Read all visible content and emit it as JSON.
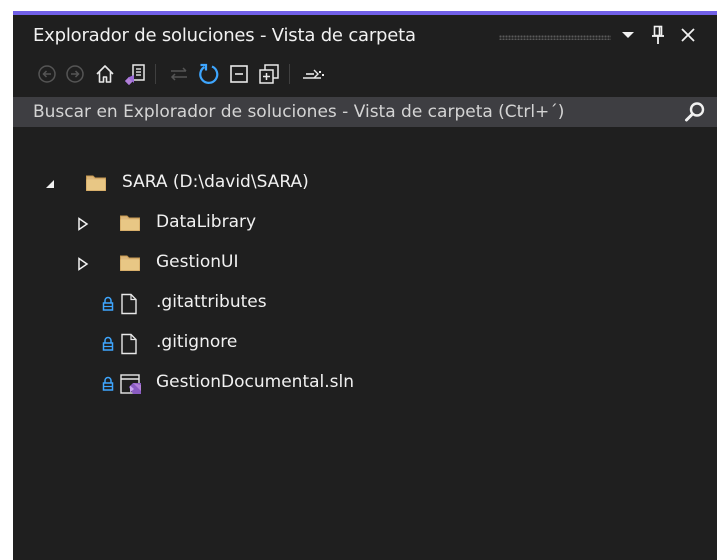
{
  "window": {
    "title": "Explorador de soluciones - Vista de carpeta",
    "accent_color": "#7160e8",
    "background_color": "#1f1f1f"
  },
  "title_buttons": [
    {
      "name": "dropdown-arrow-icon"
    },
    {
      "name": "pin-icon"
    },
    {
      "name": "close-icon"
    }
  ],
  "toolbar": {
    "buttons": [
      {
        "name": "back-icon",
        "enabled": false
      },
      {
        "name": "forward-icon",
        "enabled": false
      },
      {
        "name": "home-icon",
        "enabled": true
      },
      {
        "name": "switch-views-icon",
        "enabled": true
      },
      {
        "name": "sync-with-active-document-icon",
        "enabled": false
      },
      {
        "name": "refresh-icon",
        "enabled": true
      },
      {
        "name": "collapse-all-icon",
        "enabled": true
      },
      {
        "name": "show-all-files-icon",
        "enabled": true
      },
      {
        "name": "properties-icon",
        "enabled": true
      }
    ]
  },
  "search": {
    "placeholder": "Buscar en Explorador de soluciones - Vista de carpeta (Ctrl+´)",
    "icon": "search-icon"
  },
  "tree": {
    "items": [
      {
        "label": "SARA (D:\\david\\SARA)",
        "type": "folder",
        "expanded": true,
        "level": 0,
        "icon": "folder-icon"
      },
      {
        "label": "DataLibrary",
        "type": "folder",
        "expanded": false,
        "level": 1,
        "icon": "folder-icon"
      },
      {
        "label": "GestionUI",
        "type": "folder",
        "expanded": false,
        "level": 1,
        "icon": "folder-icon"
      },
      {
        "label": ".gitattributes",
        "type": "file",
        "locked": true,
        "level": 1,
        "icon": "file-icon"
      },
      {
        "label": ".gitignore",
        "type": "file",
        "locked": true,
        "level": 1,
        "icon": "file-icon"
      },
      {
        "label": "GestionDocumental.sln",
        "type": "solution",
        "locked": true,
        "level": 1,
        "icon": "visual-studio-solution-icon"
      }
    ]
  }
}
